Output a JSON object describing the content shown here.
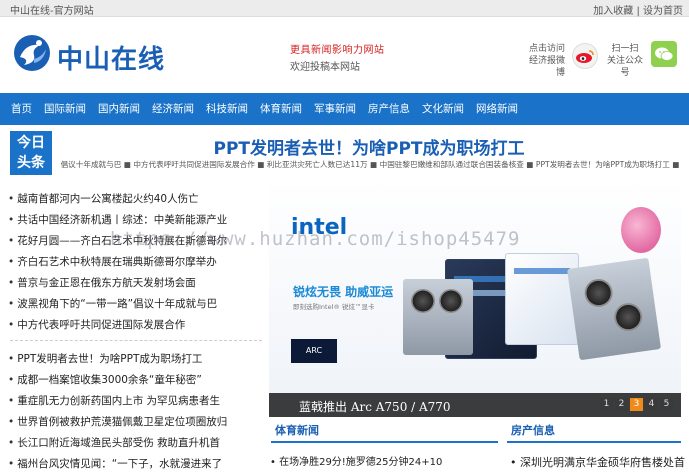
{
  "topbar": {
    "site_name": "中山在线-官方网站",
    "links": "加入收藏 | 设为首页"
  },
  "header": {
    "logo_text": "中山在线",
    "slogan": "更具新闻影响力网站",
    "welcome": "欢迎投稿本网站",
    "weibo_label_1": "点击访问",
    "weibo_label_2": "经济报微博",
    "wechat_label_1": "扫一扫",
    "wechat_label_2": "关注公众号"
  },
  "nav": {
    "items": [
      "首页",
      "国际新闻",
      "国内新闻",
      "经济新闻",
      "科技新闻",
      "体育新闻",
      "军事新闻",
      "房产信息",
      "文化新闻",
      "网络新闻"
    ]
  },
  "today": {
    "badge_line1": "今日",
    "badge_line2": "头条",
    "headline": "PPT发明者去世！为啥PPT成为职场打工",
    "subheads": "倡议十年成就与巴 ■ 中方代表呼吁共同促进国际发展合作 ■ 利比亚洪灾死亡人数已达11万 ■ 中国驻黎巴嫩维和部队通过联合国装备核查 ■ PPT发明者去世！为啥PPT成为职场打工 ■"
  },
  "news_list_a": [
    "越南首都河内一公寓楼起火约40人伤亡",
    "共话中国经济新机遇丨综述：中美新能源产业",
    "花好月圆——齐白石艺术中秋特展在斯德哥尔",
    "齐白石艺术中秋特展在瑞典斯德哥尔摩举办",
    "普京与金正恩在俄东方航天发射场会面",
    "波黑视角下的“一带一路”倡议十年成就与巴",
    "中方代表呼吁共同促进国际发展合作"
  ],
  "news_list_b": [
    "PPT发明者去世！为啥PPT成为职场打工",
    "成都一档案馆收集3000余条“童年秘密”",
    "重症肌无力创新药国内上市 为罕见病患者生",
    "世界首例被救护荒漠猫佩戴卫星定位项圈放归",
    "长江口附近海域渔民头部受伤 救助直升机首",
    "福州台风灾情见闻：“一下子，水就漫进来了"
  ],
  "carousel": {
    "brand": "intel",
    "promo_title": "锐炫无畏  助威亚运",
    "promo_body": "即刻选购Intel® 锐炫™显卡",
    "arc_badge": "ARC",
    "caption": "蓝戟推出 Arc A750 / A770",
    "pages": [
      "1",
      "2",
      "3",
      "4",
      "5"
    ],
    "active_page": "3"
  },
  "watermark": "https://www.huzhan.com/ishop45479",
  "sections": {
    "sports_title": "体育新闻",
    "sports_item": "在场净胜29分!施罗德25分钟24+10",
    "house_title": "房产信息",
    "house_item": "深圳光明满京华金硕华府售楼处首"
  },
  "colors": {
    "brand_blue": "#1a73c8",
    "headline_blue": "#1a5fb4",
    "slogan_red": "#d61c1c",
    "pager_active": "#f08a1a"
  }
}
